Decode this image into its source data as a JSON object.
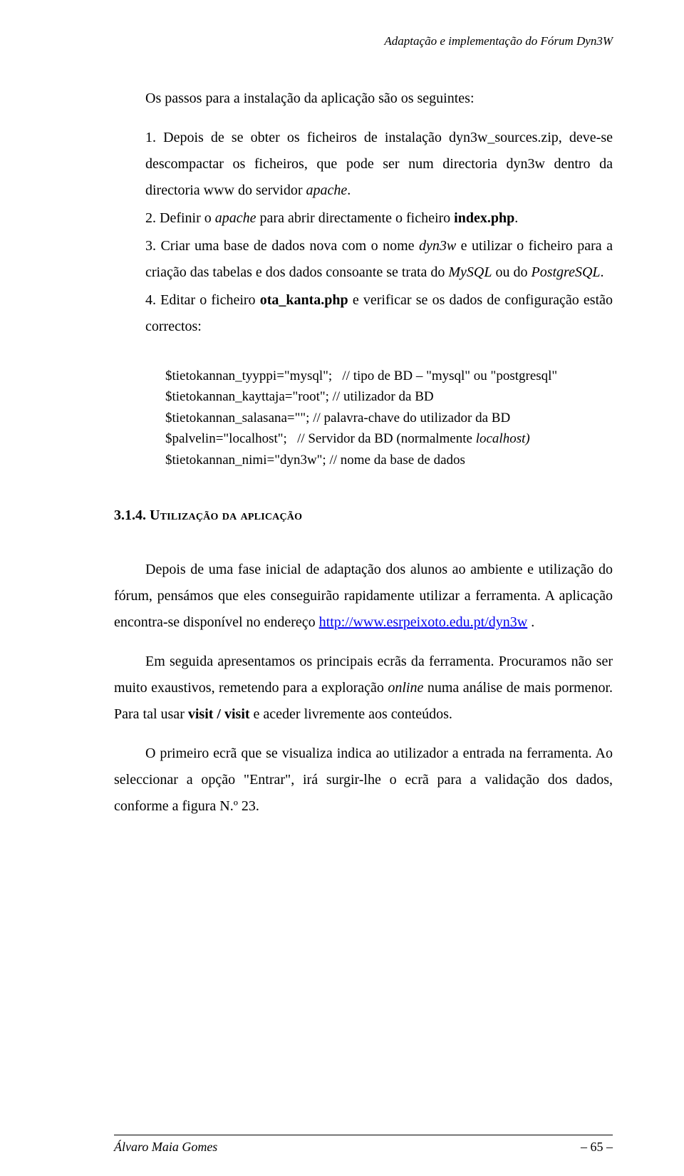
{
  "header": {
    "running_title": "Adaptação e implementação do Fórum Dyn3W"
  },
  "intro": {
    "text": "Os passos para a instalação da aplicação são os seguintes:"
  },
  "steps": [
    {
      "num": "1.",
      "pre": "Depois de se obter os ficheiros de instalação dyn3w_sources.zip, deve-se descompactar os ficheiros, que pode ser num directoria dyn3w dentro da directoria www do servidor ",
      "italic1": "apache",
      "post": "."
    },
    {
      "num": "2.",
      "pre": "Definir o ",
      "italic1": "apache",
      "mid": " para abrir directamente o ficheiro ",
      "bold1": "index.php",
      "post": "."
    },
    {
      "num": "3.",
      "pre": "Criar uma base de dados nova com o nome ",
      "italic1": "dyn3w",
      "mid": " e utilizar o ficheiro para a criação das tabelas e dos dados consoante se trata do ",
      "italic2": "MySQL",
      "mid2": " ou do ",
      "italic3": "PostgreSQL",
      "post": "."
    },
    {
      "num": "4.",
      "pre": "Editar o ficheiro ",
      "bold1": "ota_kanta.php",
      "post": " e verificar se os dados de configuração estão correctos:"
    }
  ],
  "config": {
    "l1a": "$tietokannan_tyyppi=\"mysql\";   ",
    "l1b": "// tipo de BD – \"mysql\" ou \"postgresql\"",
    "l2a": "$tietokannan_kayttaja=\"root\"; ",
    "l2b": "// utilizador da BD",
    "l3a": "$tietokannan_salasana=\"\"; ",
    "l3b": "// palavra-chave do utilizador da BD",
    "l4a": "$palvelin=\"localhost\";   ",
    "l4b": "// Servidor da BD (normalmente ",
    "l4c": "localhost)",
    "l5a": "$tietokannan_nimi=\"dyn3w\"; ",
    "l5b": "// nome da base de dados"
  },
  "section": {
    "num": "3.1.4. ",
    "title": "Utilização da aplicação"
  },
  "body": {
    "p1a": "Depois de uma fase inicial de adaptação dos alunos ao ambiente e utilização do fórum, pensámos que eles conseguirão rapidamente utilizar a ferramenta. A aplicação encontra-se disponível no endereço ",
    "p1_link": "http://www.esrpeixoto.edu.pt/dyn3w",
    "p1b": " .",
    "p2a": "Em seguida apresentamos os principais ecrãs da ferramenta. Procuramos não ser muito exaustivos, remetendo para a exploração ",
    "p2_italic": "online",
    "p2b": " numa análise de mais pormenor. Para tal usar ",
    "p2_bold": "visit / visit",
    "p2c": " e aceder livremente aos conteúdos.",
    "p3": "O primeiro ecrã que se visualiza indica ao utilizador a entrada na ferramenta. Ao seleccionar a opção \"Entrar\", irá surgir-lhe o ecrã para a validação dos dados, conforme a figura N.º 23."
  },
  "footer": {
    "author": "Álvaro Maia Gomes",
    "page": "– 65 –"
  }
}
